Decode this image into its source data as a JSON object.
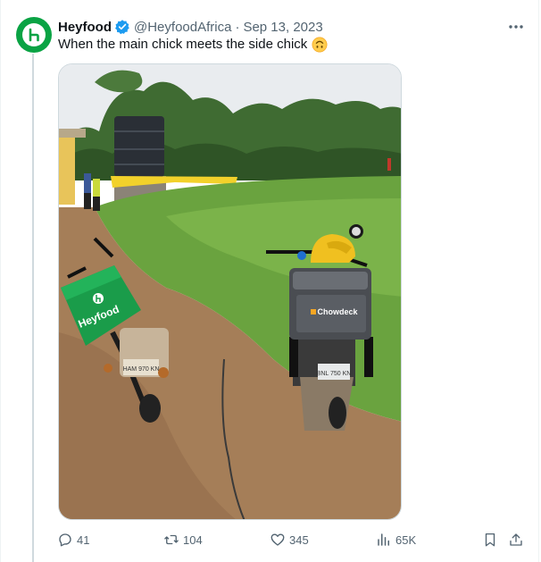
{
  "author": {
    "display_name": "Heyfood",
    "handle": "@HeyfoodAfrica",
    "separator": "·",
    "date": "Sep 13, 2023",
    "verified": true,
    "avatar_color": "#0aa344"
  },
  "tweet": {
    "text": "When the main chick meets the side chick",
    "emoji": "upside-down-face-emoji"
  },
  "media": {
    "box_labels": {
      "left_box": "Heyfood",
      "right_box": "Chowdeck"
    },
    "plates": {
      "left_plate": "HAM 970 KN",
      "right_plate": "BNL 750 KN"
    }
  },
  "actions": {
    "replies": "41",
    "reposts": "104",
    "likes": "345",
    "views": "65K"
  },
  "colors": {
    "text_primary": "#0f1419",
    "text_secondary": "#536471",
    "verified_blue": "#1d9bf0",
    "heyfood_green": "#0aa344",
    "chowdeck_orange": "#f5a623"
  }
}
